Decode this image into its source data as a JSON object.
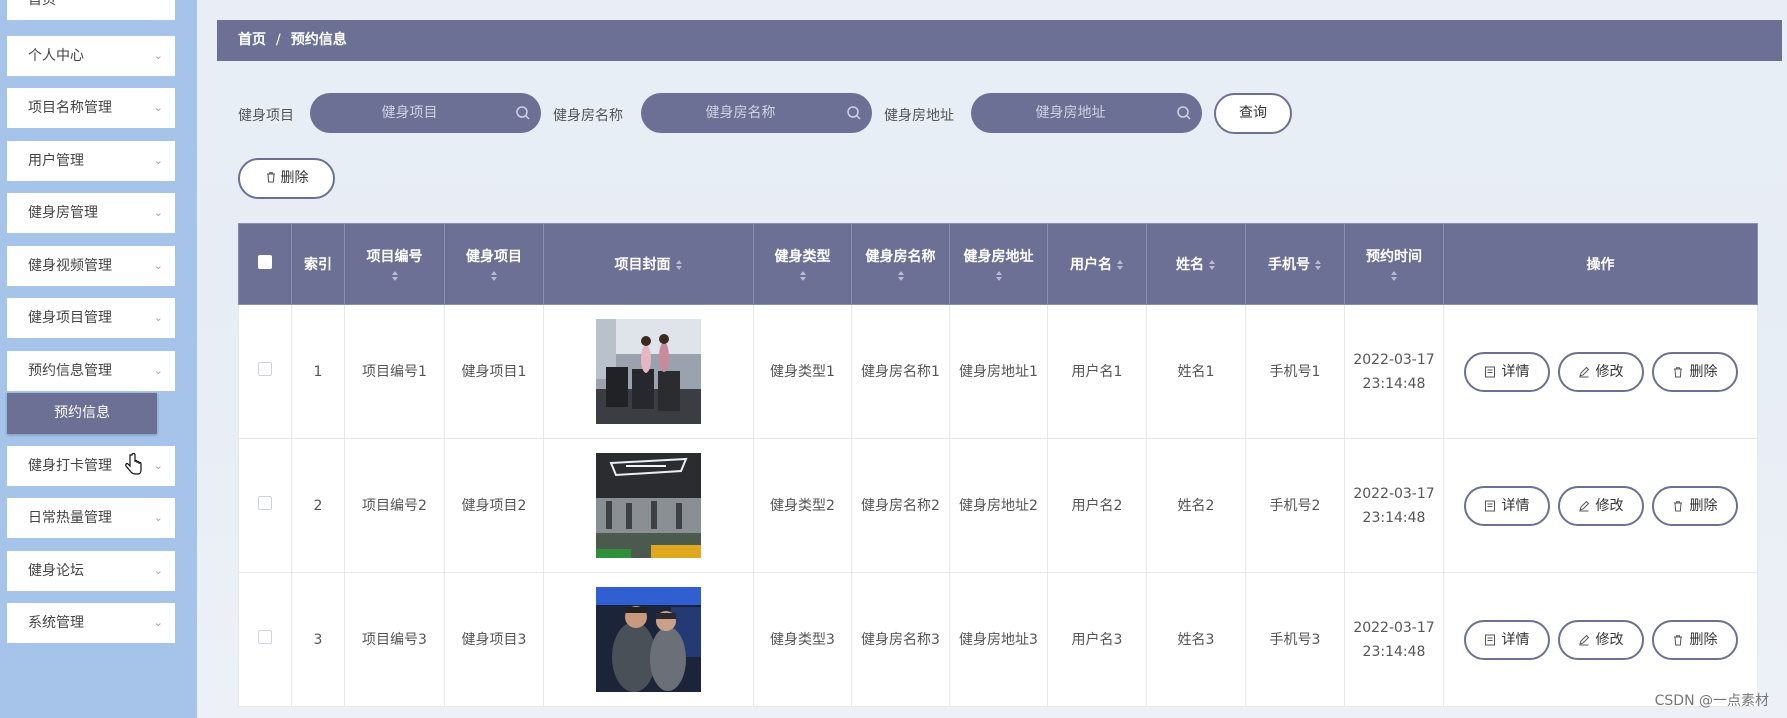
{
  "sidebar": {
    "items": [
      {
        "label": "首页"
      },
      {
        "label": "个人中心"
      },
      {
        "label": "项目名称管理"
      },
      {
        "label": "用户管理"
      },
      {
        "label": "健身房管理"
      },
      {
        "label": "健身视频管理"
      },
      {
        "label": "健身项目管理"
      },
      {
        "label": "预约信息管理"
      },
      {
        "label": "健身打卡管理"
      },
      {
        "label": "日常热量管理"
      },
      {
        "label": "健身论坛"
      },
      {
        "label": "系统管理"
      }
    ],
    "active_sub": "预约信息"
  },
  "breadcrumb": {
    "home": "首页",
    "sep": "/",
    "current": "预约信息"
  },
  "search": {
    "f1_label": "健身项目",
    "f1_placeholder": "健身项目",
    "f2_label": "健身房名称",
    "f2_placeholder": "健身房名称",
    "f3_label": "健身房地址",
    "f3_placeholder": "健身房地址",
    "query_button": "查询",
    "delete_button": "删除"
  },
  "table": {
    "headers": [
      "索引",
      "项目编号",
      "健身项目",
      "项目封面",
      "健身类型",
      "健身房名称",
      "健身房地址",
      "用户名",
      "姓名",
      "手机号",
      "预约时间",
      "操作"
    ],
    "rows": [
      {
        "index": "1",
        "code": "项目编号1",
        "item": "健身项目1",
        "type": "健身类型1",
        "gym_name": "健身房名称1",
        "gym_addr": "健身房地址1",
        "username": "用户名1",
        "name": "姓名1",
        "phone": "手机号1",
        "time": "2022-03-17 23:14:48"
      },
      {
        "index": "2",
        "code": "项目编号2",
        "item": "健身项目2",
        "type": "健身类型2",
        "gym_name": "健身房名称2",
        "gym_addr": "健身房地址2",
        "username": "用户名2",
        "name": "姓名2",
        "phone": "手机号2",
        "time": "2022-03-17 23:14:48"
      },
      {
        "index": "3",
        "code": "项目编号3",
        "item": "健身项目3",
        "type": "健身类型3",
        "gym_name": "健身房名称3",
        "gym_addr": "健身房地址3",
        "username": "用户名3",
        "name": "姓名3",
        "phone": "手机号3",
        "time": "2022-03-17 23:14:48"
      }
    ],
    "actions": {
      "detail": "详情",
      "edit": "修改",
      "delete": "删除"
    }
  },
  "watermark": "CSDN @一点素材",
  "colors": {
    "primary": "#6c7095",
    "sidebar": "#a6c4ea"
  }
}
